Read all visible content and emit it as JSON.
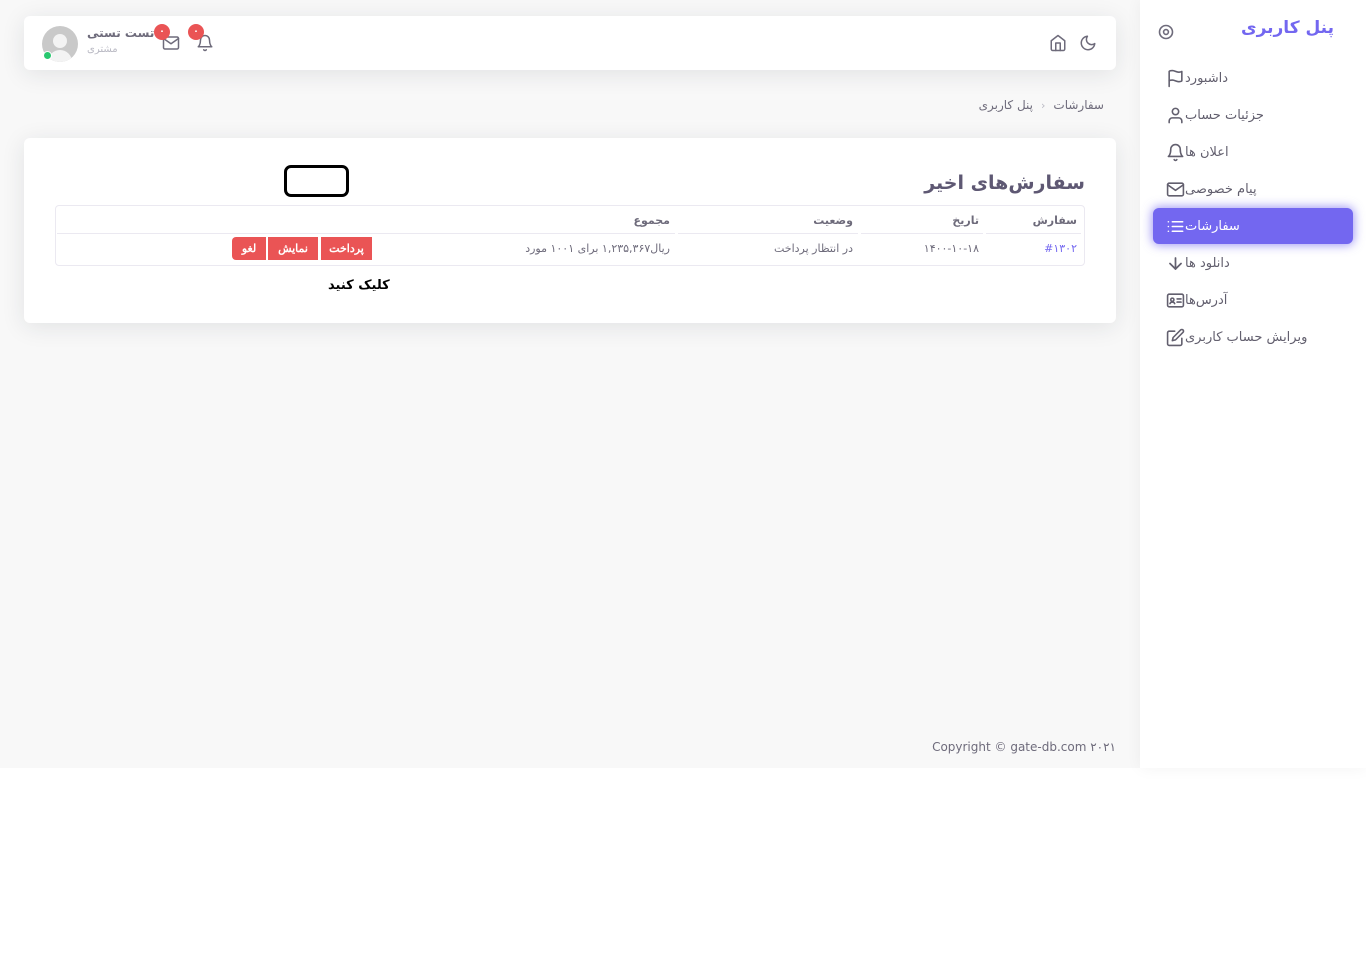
{
  "sidebar": {
    "brand": "پنل کاربری",
    "items": [
      {
        "label": "داشبورد",
        "icon": "flag-icon"
      },
      {
        "label": "جزئیات حساب",
        "icon": "user-icon"
      },
      {
        "label": "اعلان ها",
        "icon": "bell-icon"
      },
      {
        "label": "پیام خصوصی",
        "icon": "mail-icon"
      },
      {
        "label": "سفارشات",
        "icon": "list-icon",
        "active": true
      },
      {
        "label": "دانلود ها",
        "icon": "arrow-down-icon"
      },
      {
        "label": "آدرس‌ها",
        "icon": "address-card-icon"
      },
      {
        "label": "ویرایش حساب کاربری",
        "icon": "edit-icon"
      }
    ]
  },
  "navbar": {
    "user_name": "تست تستی",
    "user_role": "مشتری",
    "mail_count": "۰",
    "notification_count": "۰"
  },
  "breadcrumb": {
    "root": "پنل کاربری",
    "current": "سفارشات"
  },
  "orders": {
    "title": "سفارش‌های اخیر",
    "columns": [
      "سفارش",
      "تاریخ",
      "وضعیت",
      "مجموع"
    ],
    "rows": [
      {
        "order": "#۱۳۰۲",
        "date": "۱۴۰۰-۱۰-۱۸",
        "status": "در انتظار پرداخت",
        "total": "ریال۱,۲۳۵,۳۶۷ برای ۱۰۰۱ مورد",
        "actions": {
          "pay": "پرداخت",
          "view": "نمایش",
          "cancel": "لغو"
        }
      }
    ],
    "click_hint": "کلیک کنید"
  },
  "footer": {
    "copyright": "Copyright © gate-db.com ۲۰۲۱"
  },
  "colors": {
    "primary": "#7367f0",
    "danger": "#ea5455",
    "online": "#28c76f",
    "background": "#f8f8f8"
  }
}
